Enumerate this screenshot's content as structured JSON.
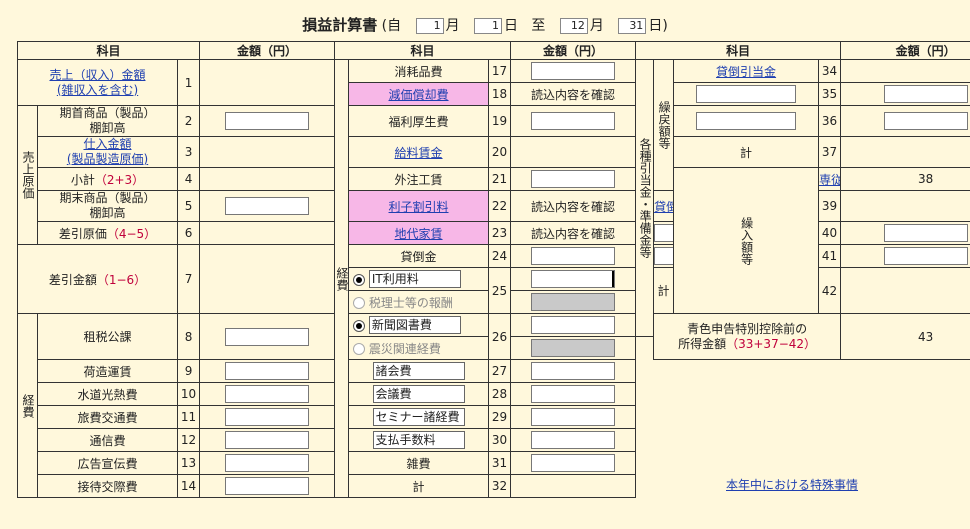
{
  "header": {
    "title": "損益計算書",
    "from_label": "(自",
    "to_label": "至",
    "month_unit": "月",
    "day_unit": "日",
    "close_paren": ")",
    "from_month": "1",
    "from_day": "1",
    "to_month": "12",
    "to_day": "31"
  },
  "columns": {
    "item": "科目",
    "amount": "金額（円）"
  },
  "labels": {
    "sales_l1": "売上（収入）金額",
    "sales_l2": "(雑収入を含む)",
    "cost_group": "売上原価",
    "opening_l1": "期首商品（製品）",
    "opening_l2": "棚卸高",
    "purchase_l1": "仕入金額",
    "purchase_l2": "(製品製造原価)",
    "subtotal": "小計",
    "subtotal_formula": "（2+3）",
    "closing_l1": "期末商品（製品）",
    "closing_l2": "棚卸高",
    "diff_cost": "差引原価",
    "diff_cost_formula": "（4−5）",
    "diff_amount": "差引金額",
    "diff_amount_formula": "（1−6）",
    "expense_group": "経費",
    "tax": "租税公課",
    "freight": "荷造運賃",
    "utilities": "水道光熱費",
    "travel": "旅費交通費",
    "comm": "通信費",
    "ads": "広告宣伝費",
    "entertain": "接待交際費",
    "supplies": "消耗品費",
    "depreciation": "減価償却費",
    "welfare": "福利厚生費",
    "wages": "給料賃金",
    "outsourcing": "外注工賃",
    "interest": "利子割引料",
    "rent": "地代家賃",
    "bad_debt": "貸倒金",
    "it_fee": "IT利用料",
    "tax_accountant": "税理士等の報酬",
    "newspaper": "新聞図書費",
    "disaster": "震災関連経費",
    "dues": "諸会費",
    "meeting": "会議費",
    "seminar": "セミナー諸経費",
    "fees": "支払手数料",
    "misc": "雑費",
    "total": "計",
    "reserves_group": "各種引当金・準備金等",
    "reversal_group": "繰戻額等",
    "transfer_group": "繰入額等",
    "bad_debt_reserve": "貸倒引当金",
    "family_salary": "専従者給与",
    "blue_l1": "青色申告特別控除前の",
    "blue_l2": "所得金額",
    "blue_formula": "（33+37−42）",
    "read_confirm": "読込内容を確認",
    "special_circumstances": "本年中における特殊事情"
  },
  "numbers": [
    "1",
    "2",
    "3",
    "4",
    "5",
    "6",
    "7",
    "8",
    "9",
    "10",
    "11",
    "12",
    "13",
    "14",
    "17",
    "18",
    "19",
    "20",
    "21",
    "22",
    "23",
    "24",
    "25",
    "26",
    "27",
    "28",
    "29",
    "30",
    "31",
    "32",
    "34",
    "35",
    "36",
    "37",
    "38",
    "39",
    "40",
    "41",
    "42",
    "43"
  ]
}
